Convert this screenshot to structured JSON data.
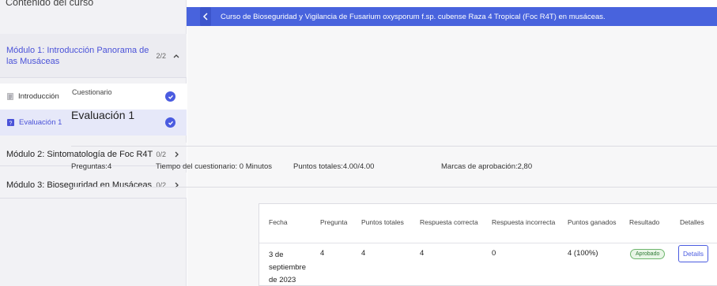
{
  "sidebar": {
    "title": "Contenido del curso",
    "modules": [
      {
        "title": "Módulo 1: Introducción Panorama de las Musáceas",
        "count": "2/2"
      },
      {
        "title": "Módulo 2: Sintomatología de Foc R4T",
        "count": "0/2"
      },
      {
        "title": "Módulo 3: Bioseguridad en Musáceas",
        "count": "0/2"
      }
    ],
    "lessons": [
      {
        "label": "Introducción"
      },
      {
        "label": "Evaluación 1"
      }
    ]
  },
  "header": {
    "course_title": "Curso de Bioseguridad y Vigilancia de Fusarium oxysporum f.sp. cubense Raza 4 Tropical (Foc R4T) en musáceas."
  },
  "quiz": {
    "type_label": "Cuestionario",
    "name": "Evaluación 1",
    "stats": {
      "questions": "Preguntas:4",
      "time": "Tiempo del cuestionario: 0 Minutos",
      "points": "Puntos totales:4.00/4.00",
      "pass_marks": "Marcas de aprobación:2,80"
    }
  },
  "results_table": {
    "headers": [
      "Fecha",
      "Pregunta",
      "Puntos totales",
      "Respuesta correcta",
      "Respuesta incorrecta",
      "Puntos ganados",
      "Resultado",
      "Detalles"
    ],
    "row": {
      "date": "3 de septiembre de 2023",
      "question": "4",
      "total_points": "4",
      "correct": "4",
      "incorrect": "0",
      "earned": "4 (100%)",
      "result": "Aprobado",
      "details_label": "Details"
    }
  },
  "colors": {
    "accent": "#4863dd",
    "link": "#4a52d8",
    "pass_green": "#2f7a36"
  }
}
